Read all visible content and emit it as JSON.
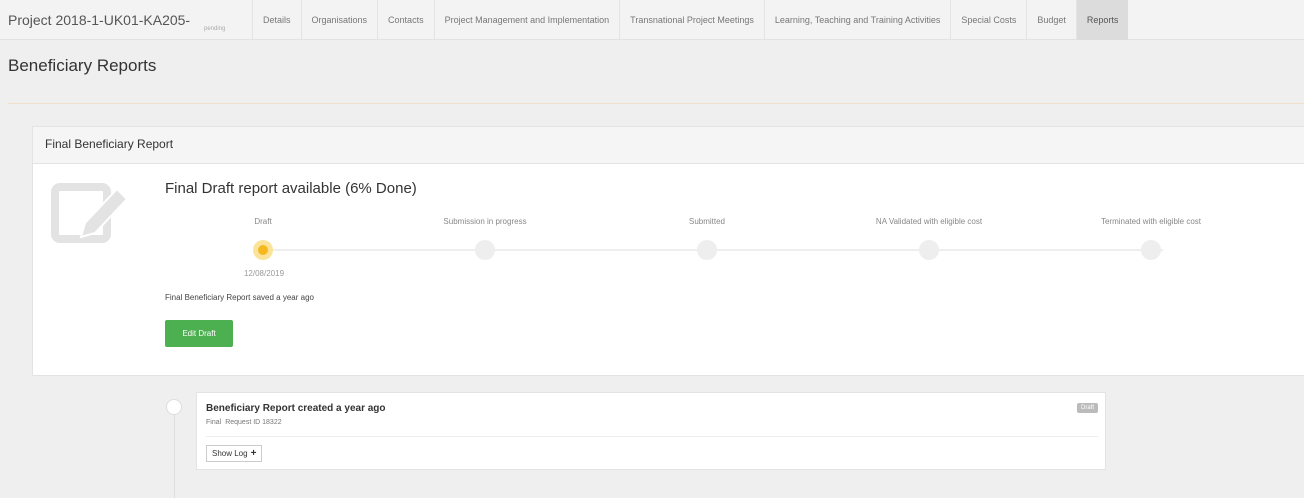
{
  "header": {
    "project": "Project 2018-1-UK01-KA205-",
    "project_sub": "pending",
    "tabs": [
      {
        "label": "Details"
      },
      {
        "label": "Organisations"
      },
      {
        "label": "Contacts"
      },
      {
        "label": "Project Management and Implementation"
      },
      {
        "label": "Transnational Project Meetings"
      },
      {
        "label": "Learning, Teaching and Training Activities"
      },
      {
        "label": "Special Costs"
      },
      {
        "label": "Budget"
      },
      {
        "label": "Reports"
      }
    ],
    "active_tab": "Reports"
  },
  "page": {
    "title": "Beneficiary Reports"
  },
  "panel": {
    "header": "Final Beneficiary Report",
    "status_title": "Final Draft report available (6% Done)",
    "progress_percent": 6,
    "steps": [
      {
        "label": "Draft",
        "date": "12/08/2019",
        "active": true
      },
      {
        "label": "Submission in progress",
        "active": false
      },
      {
        "label": "Submitted",
        "active": false
      },
      {
        "label": "NA Validated with eligible cost",
        "active": false
      },
      {
        "label": "Terminated with eligible cost",
        "active": false
      }
    ],
    "saved_text": "Final Beneficiary Report saved a year ago",
    "edit_button": "Edit Draft"
  },
  "timeline": {
    "title": "Beneficiary Report created a year ago",
    "badge": "Draft",
    "type": "Final",
    "request": "Request ID 18322",
    "show_log": "Show Log",
    "show_log_icon": "plus-icon"
  },
  "colors": {
    "accent_green": "#4caf50",
    "active_step": "#f5b821",
    "active_tab_bg": "#dcdcdc"
  }
}
